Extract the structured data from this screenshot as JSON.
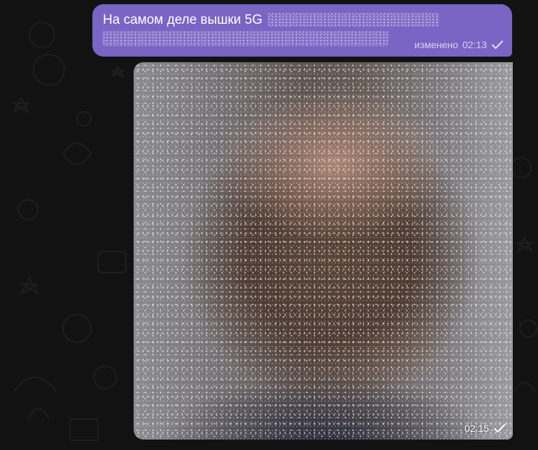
{
  "messages": [
    {
      "type": "text",
      "text": "На самом деле вышки 5G",
      "status_label": "изменено",
      "time": "02:13",
      "read_state_icon": "single-check-icon",
      "has_spoiler": true
    },
    {
      "type": "photo",
      "time": "02:15",
      "read_state_icon": "single-check-icon",
      "has_spoiler": true
    }
  ],
  "colors": {
    "outgoing_bubble": "#7a64c4",
    "chat_background": "#121212",
    "meta_text": "#ffffff"
  }
}
